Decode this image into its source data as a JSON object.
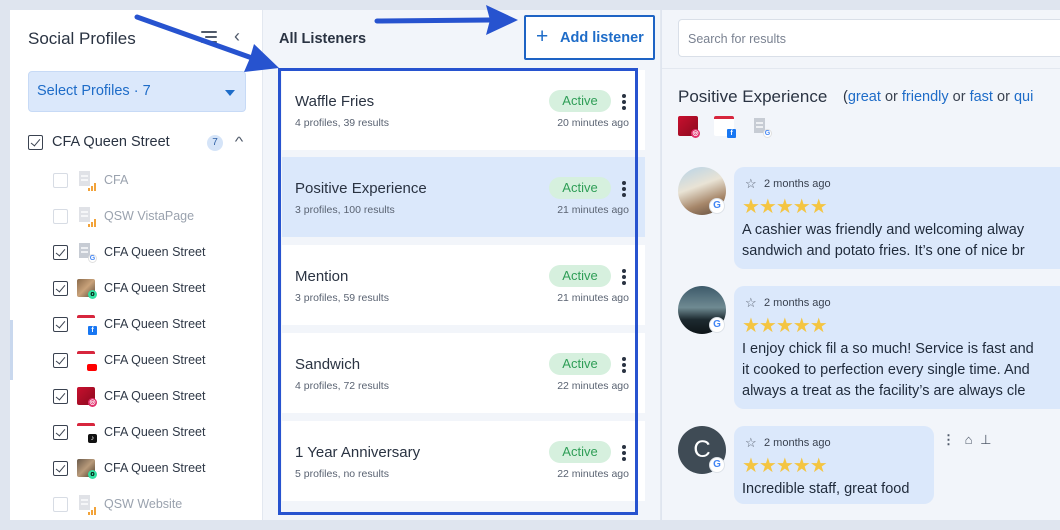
{
  "left": {
    "title": "Social Profiles",
    "select_label": "Select Profiles · 7",
    "group": {
      "label": "CFA Queen Street",
      "count": "7",
      "checked": true
    },
    "profiles": [
      {
        "label": "CFA",
        "checked": false,
        "disabled": true,
        "icon": "building-icon",
        "badge": "bars"
      },
      {
        "label": "QSW VistaPage",
        "checked": false,
        "disabled": true,
        "icon": "building-icon",
        "badge": "bars"
      },
      {
        "label": "CFA Queen Street",
        "checked": true,
        "disabled": false,
        "icon": "building-icon",
        "badge": "google"
      },
      {
        "label": "CFA Queen Street",
        "checked": true,
        "disabled": false,
        "icon": "photo-icon",
        "badge": "tripadvisor"
      },
      {
        "label": "CFA Queen Street",
        "checked": true,
        "disabled": false,
        "icon": "brand-logo-icon",
        "badge": "facebook"
      },
      {
        "label": "CFA Queen Street",
        "checked": true,
        "disabled": false,
        "icon": "brand-logo-icon",
        "badge": "youtube"
      },
      {
        "label": "CFA Queen Street",
        "checked": true,
        "disabled": false,
        "icon": "red-photo-icon",
        "badge": "instagram"
      },
      {
        "label": "CFA Queen Street",
        "checked": true,
        "disabled": false,
        "icon": "brand-logo-icon",
        "badge": "tiktok"
      },
      {
        "label": "CFA Queen Street",
        "checked": true,
        "disabled": false,
        "icon": "photo-icon",
        "badge": "tripadvisor"
      },
      {
        "label": "QSW Website",
        "checked": false,
        "disabled": true,
        "icon": "building-icon",
        "badge": "bars"
      }
    ]
  },
  "middle": {
    "title": "All Listeners",
    "add_button": "Add listener",
    "listeners": [
      {
        "name": "Waffle Fries",
        "meta": "4 profiles, 39 results",
        "status": "Active",
        "time": "20 minutes ago",
        "selected": false
      },
      {
        "name": "Positive Experience",
        "meta": "3 profiles, 100 results",
        "status": "Active",
        "time": "21 minutes ago",
        "selected": true
      },
      {
        "name": "Mention",
        "meta": "3 profiles, 59 results",
        "status": "Active",
        "time": "21 minutes ago",
        "selected": false
      },
      {
        "name": "Sandwich",
        "meta": "4 profiles, 72 results",
        "status": "Active",
        "time": "22 minutes ago",
        "selected": false
      },
      {
        "name": "1 Year Anniversary",
        "meta": "5 profiles, no results",
        "status": "Active",
        "time": "22 minutes ago",
        "selected": false
      }
    ]
  },
  "right": {
    "search_placeholder": "Search for results",
    "listener_title": "Positive Experience",
    "query": {
      "open": "(",
      "kw1": "great",
      "op1": "or",
      "kw2": "friendly",
      "op2": "or",
      "kw3": "fast",
      "op3": "or",
      "kw4": "qui"
    },
    "source_icons": [
      "instagram-profile-icon",
      "facebook-profile-icon",
      "google-profile-icon"
    ],
    "reviews": [
      {
        "when": "2 months ago",
        "stars": 5,
        "lines": [
          "A cashier was friendly and welcoming alway",
          "sandwich and potato fries. It’s one of nice br"
        ],
        "avatar": "photo"
      },
      {
        "when": "2 months ago",
        "stars": 5,
        "lines": [
          "I enjoy chick fil a so much! Service is fast and",
          "it cooked to perfection every single time. And",
          "always a treat as the facility’s are always cle"
        ],
        "avatar": "landscape"
      },
      {
        "when": "2 months ago",
        "stars": 5,
        "lines": [
          "Incredible staff, great food"
        ],
        "avatar_letter": "C"
      }
    ]
  },
  "colors": {
    "accent": "#1e6cc8",
    "active_bg": "#d6f0de",
    "active_text": "#2f9e57",
    "selected_bg": "#dbe8fb",
    "annotation": "#2753cf",
    "star": "#f4c542"
  }
}
